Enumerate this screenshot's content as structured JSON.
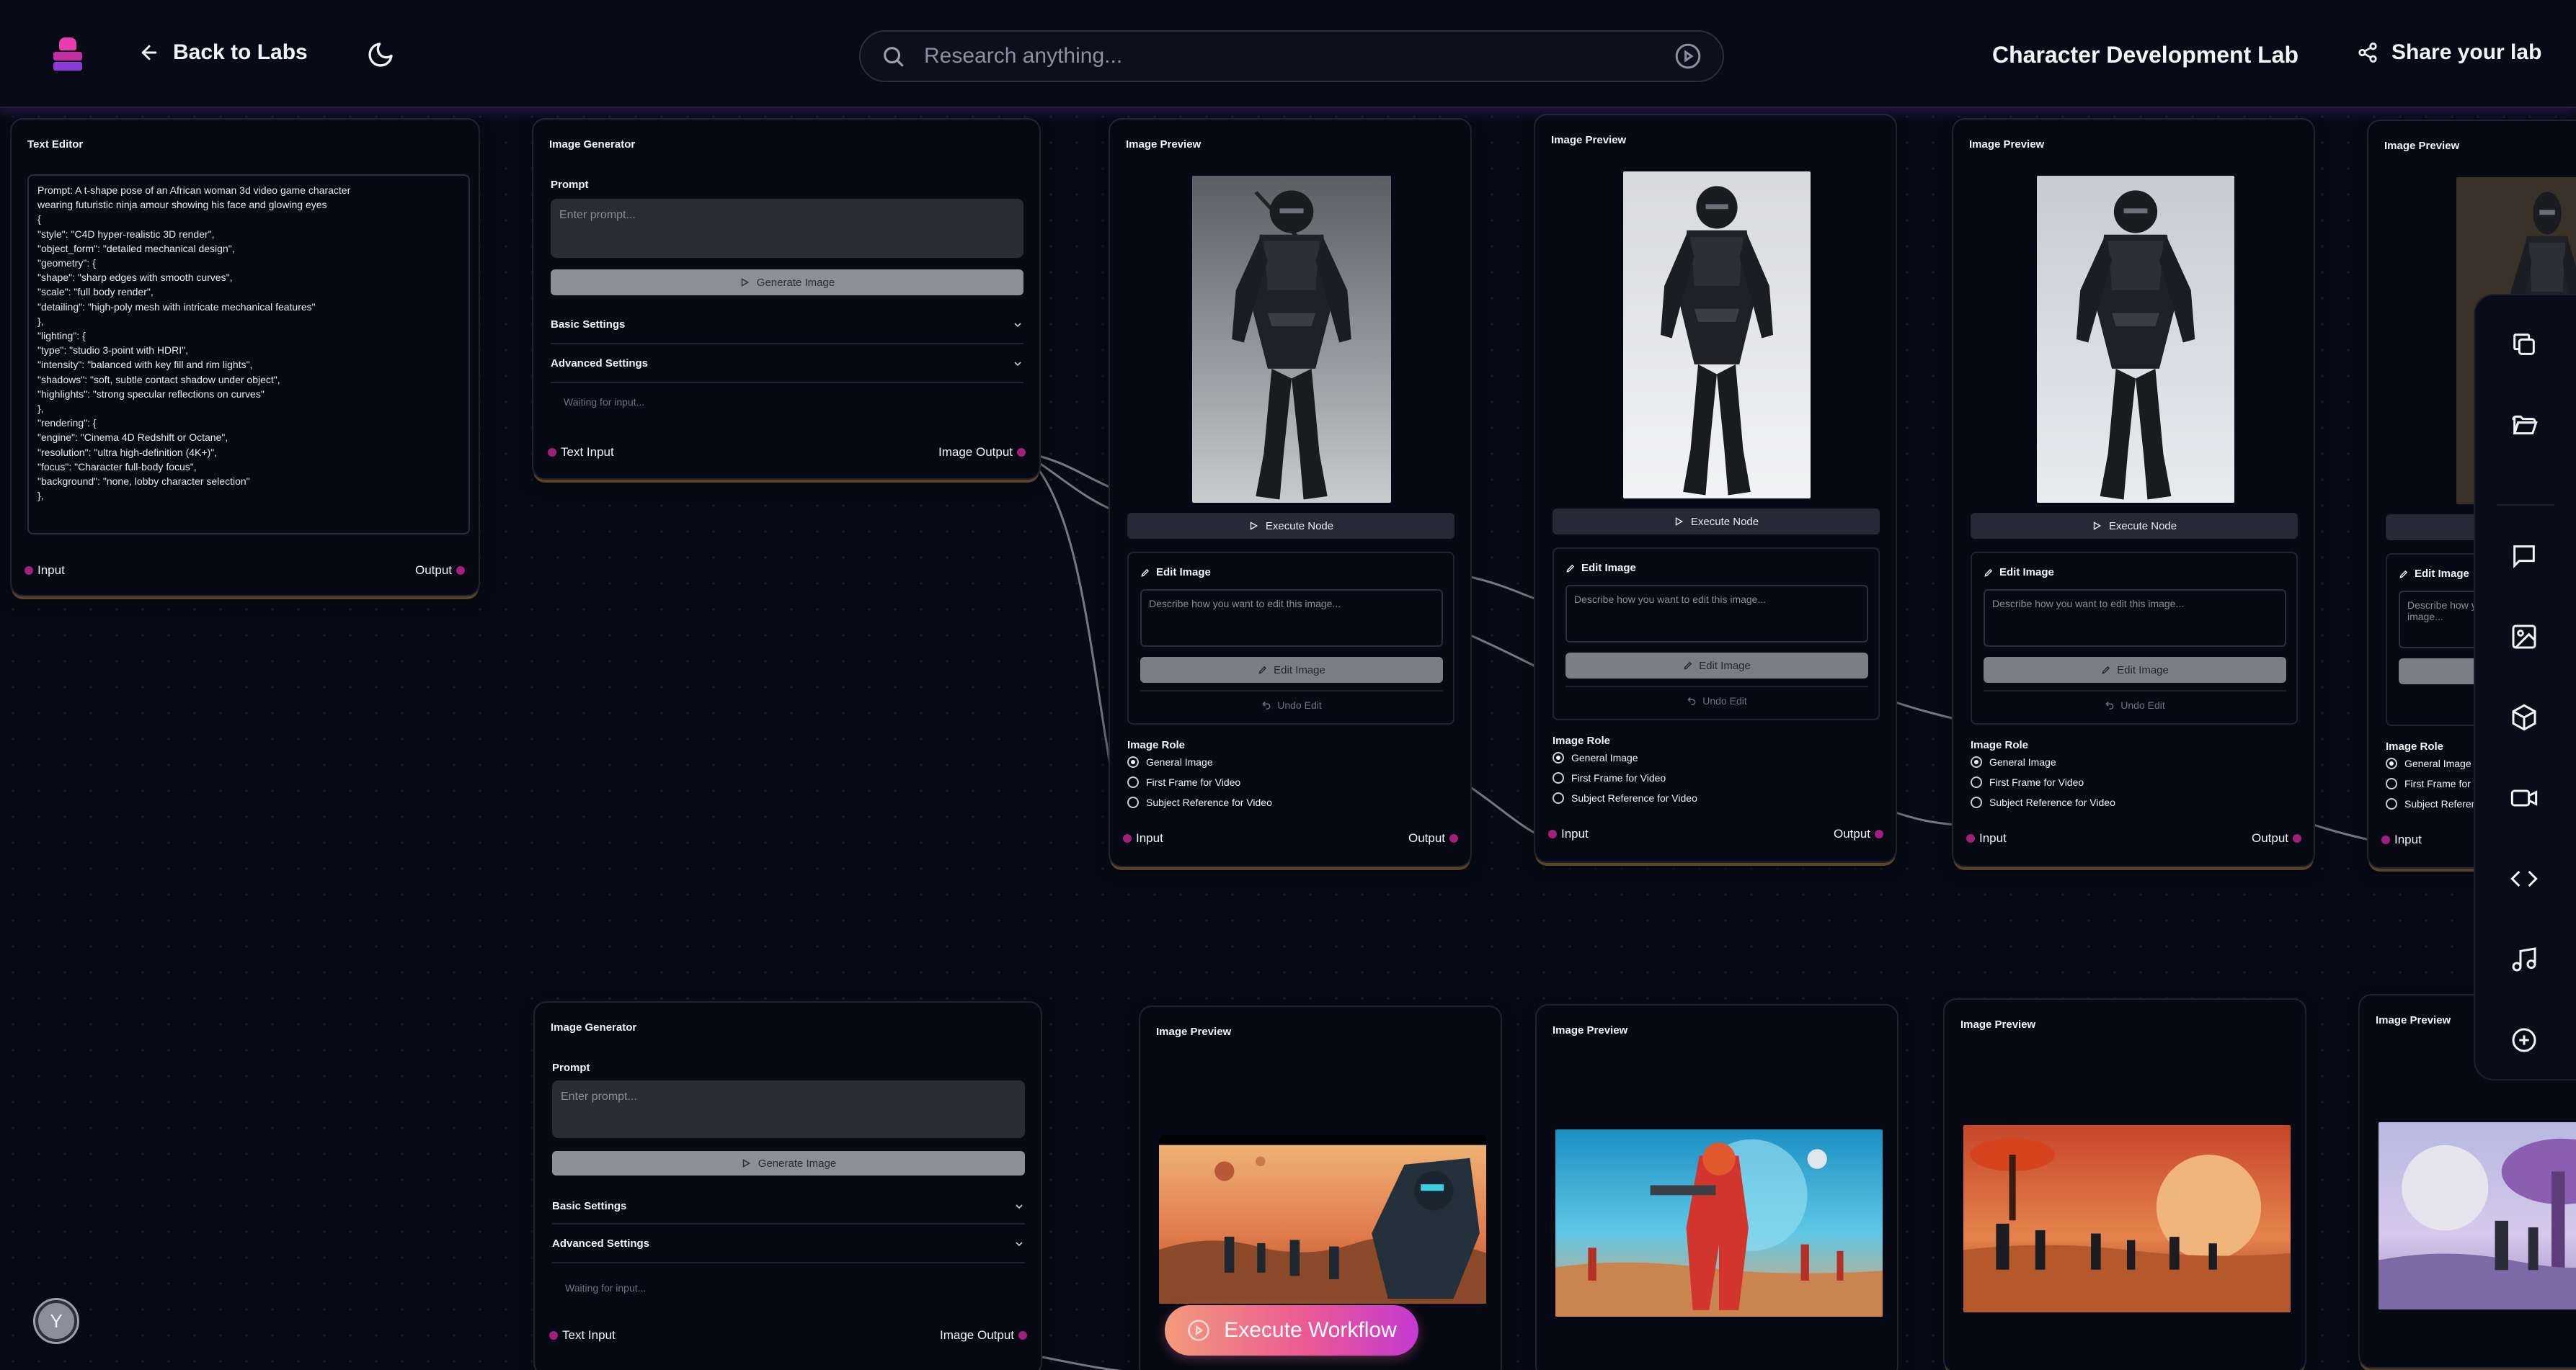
{
  "header": {
    "back_label": "Back to Labs",
    "search_placeholder": "Research anything...",
    "lab_title": "Character Development Lab",
    "share_label": "Share your lab"
  },
  "text_editor": {
    "title": "Text Editor",
    "content": "Prompt: A t-shape pose of an African woman 3d video game character\nwearing futuristic ninja amour showing his face and glowing eyes\n{\n\"style\": \"C4D hyper-realistic 3D render\",\n\"object_form\": \"detailed mechanical design\",\n\"geometry\": {\n\"shape\": \"sharp edges with smooth curves\",\n\"scale\": \"full body render\",\n\"detailing\": \"high-poly mesh with intricate mechanical features\"\n},\n\"lighting\": {\n\"type\": \"studio 3-point with HDRI\",\n\"intensity\": \"balanced with key fill and rim lights\",\n\"shadows\": \"soft, subtle contact shadow under object\",\n\"highlights\": \"strong specular reflections on curves\"\n},\n\"rendering\": {\n\"engine\": \"Cinema 4D Redshift or Octane\",\n\"resolution\": \"ultra high-definition (4K+)\",\n\"focus\": \"Character full-body focus\",\n\"background\": \"none, lobby character selection\"\n},",
    "input_label": "Input",
    "output_label": "Output"
  },
  "image_generator": {
    "title": "Image Generator",
    "prompt_label": "Prompt",
    "prompt_placeholder": "Enter prompt...",
    "generate_label": "Generate Image",
    "basic_settings": "Basic Settings",
    "advanced_settings": "Advanced Settings",
    "waiting": "Waiting for input...",
    "text_input_label": "Text Input",
    "image_output_label": "Image Output"
  },
  "image_preview": {
    "title": "Image Preview",
    "execute_label": "Execute Node",
    "edit_title": "Edit Image",
    "edit_placeholder": "Describe how you want to edit this image...",
    "edit_button": "Edit Image",
    "undo_button": "Undo Edit",
    "role_label": "Image Role",
    "roles": [
      "General Image",
      "First Frame for Video",
      "Subject Reference for Video"
    ],
    "selected_role": "General Image",
    "input_label": "Input",
    "output_label": "Output"
  },
  "toolbar": {
    "icons": [
      "copy-icon",
      "folder-icon",
      "chat-icon",
      "image-icon",
      "cube-icon",
      "video-icon",
      "code-icon",
      "music-icon",
      "add-icon"
    ]
  },
  "bottom": {
    "execute_workflow_label": "Execute Workflow",
    "avatar_initial": "Y"
  },
  "colors": {
    "background": "#080b17",
    "port": "#a0207a",
    "accent_gradient_start": "#f29a7a",
    "accent_gradient_end": "#c23ad2"
  }
}
